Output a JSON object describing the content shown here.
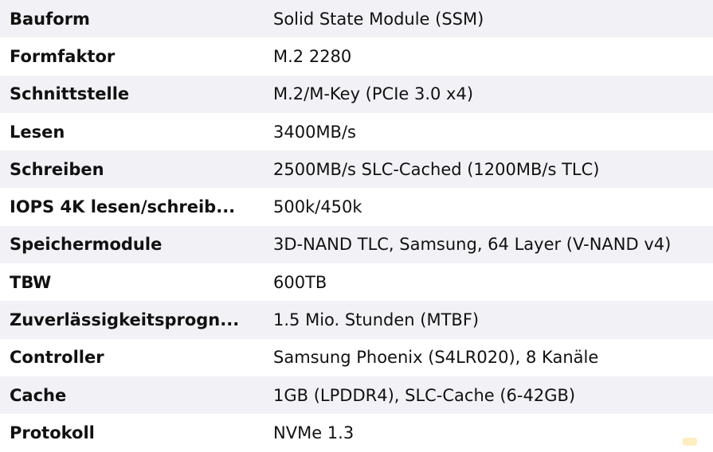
{
  "specs": [
    {
      "key": "Bauform",
      "value": "Solid State Module (SSM)"
    },
    {
      "key": "Formfaktor",
      "value": "M.2 2280"
    },
    {
      "key": "Schnittstelle",
      "value": "M.2/M-Key (PCIe 3.0 x4)"
    },
    {
      "key": "Lesen",
      "value": "3400MB/s"
    },
    {
      "key": "Schreiben",
      "value": "2500MB/s SLC-Cached (1200MB/s TLC)"
    },
    {
      "key": "IOPS 4K lesen/schreib...",
      "value": "500k/450k"
    },
    {
      "key": "Speichermodule",
      "value": "3D-NAND TLC, Samsung, 64 Layer (V-NAND v4)"
    },
    {
      "key": "TBW",
      "value": "600TB"
    },
    {
      "key": "Zuverlässigkeitsprogn...",
      "value": "1.5 Mio. Stunden (MTBF)"
    },
    {
      "key": "Controller",
      "value": "Samsung Phoenix (S4LR020), 8 Kanäle"
    },
    {
      "key": "Cache",
      "value": "1GB (LPDDR4), SLC-Cache (6-42GB)"
    },
    {
      "key": "Protokoll",
      "value": "NVMe 1.3"
    }
  ]
}
